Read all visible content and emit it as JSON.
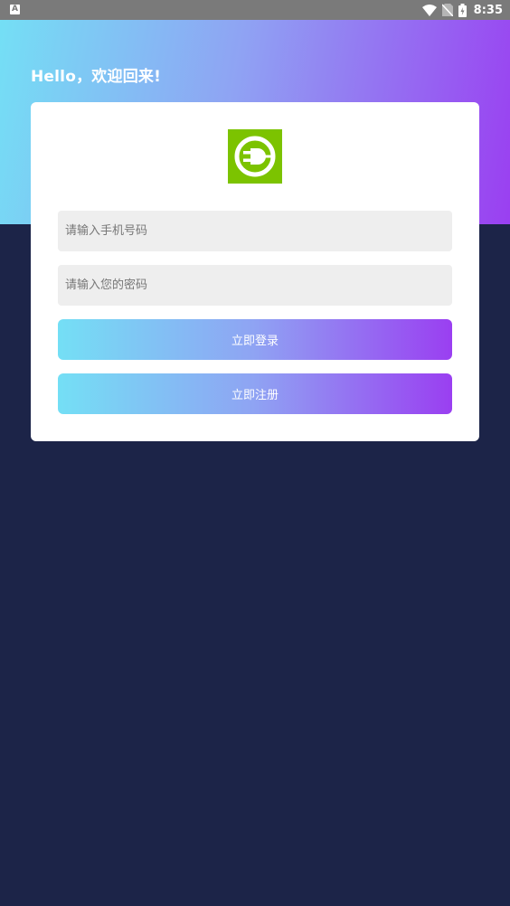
{
  "status_bar": {
    "left_icon": "A",
    "time": "8:35",
    "icons": [
      "wifi-icon",
      "no-sim-icon",
      "battery-charging-icon"
    ]
  },
  "header": {
    "greeting": "Hello，欢迎回来!",
    "gradient_colors": [
      "#74dff5",
      "#8fa3f3",
      "#9a3ff1"
    ]
  },
  "login_card": {
    "logo_icon": "plug-logo-icon",
    "logo_color": "#7cc300",
    "phone_placeholder": "请输入手机号码",
    "password_placeholder": "请输入您的密码",
    "login_button": "立即登录",
    "register_button": "立即注册"
  },
  "colors": {
    "background": "#1c2448",
    "card": "#ffffff",
    "input_bg": "#eeeeee"
  }
}
